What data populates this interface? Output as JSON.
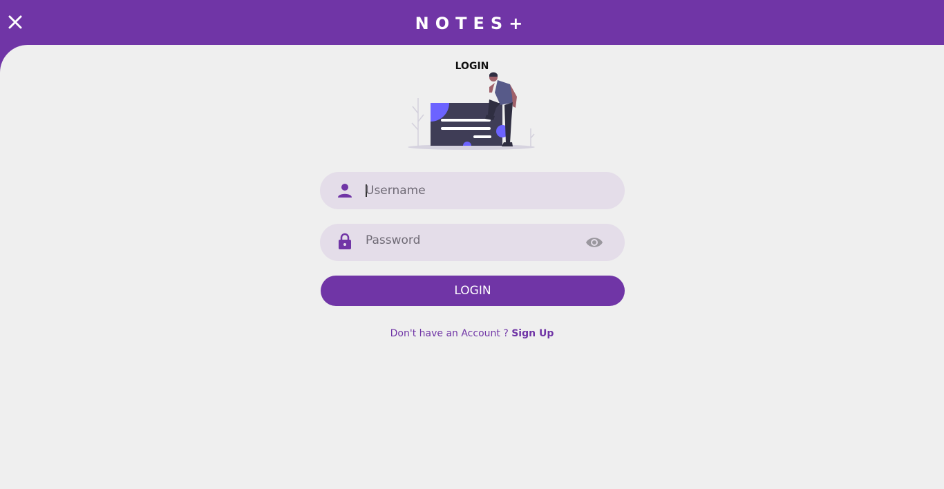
{
  "app": {
    "title": "NOTES+",
    "accent_color": "#7035a6",
    "close_icon": "close-icon"
  },
  "login": {
    "heading": "LOGIN",
    "username": {
      "placeholder": "Username",
      "value": "",
      "icon": "user-icon"
    },
    "password": {
      "placeholder": "Password",
      "value": "",
      "icon": "lock-icon",
      "toggle_icon": "eye-icon"
    },
    "submit_label": "LOGIN",
    "signup_prompt": "Don't have an Account ?",
    "signup_link": "Sign Up"
  }
}
